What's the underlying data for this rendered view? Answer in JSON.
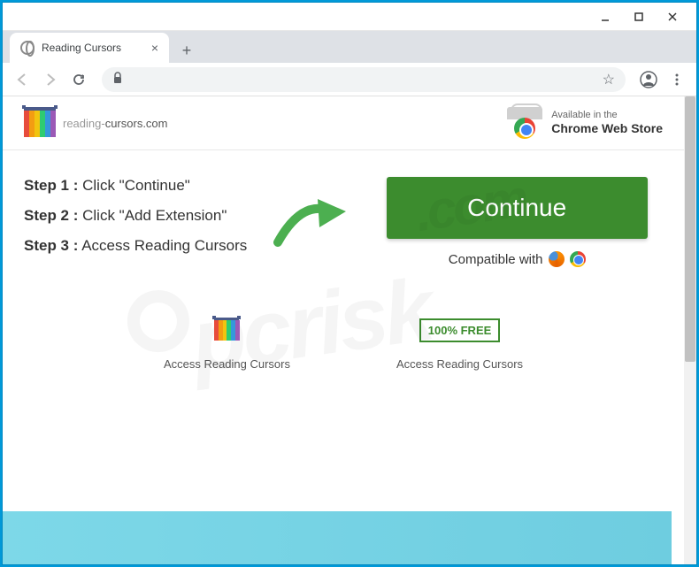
{
  "window": {
    "tab_title": "Reading Cursors"
  },
  "header": {
    "logo_text_prefix": "reading-",
    "logo_text_suffix": "cursors.com",
    "cws_line1": "Available in the",
    "cws_line2": "Chrome Web Store"
  },
  "steps": [
    {
      "label": "Step 1 :",
      "text": " Click \"Continue\""
    },
    {
      "label": "Step 2 :",
      "text": " Click \"Add Extension\""
    },
    {
      "label": "Step 3 :",
      "text": " Access Reading Cursors"
    }
  ],
  "cta": {
    "continue_label": "Continue",
    "compatible_label": "Compatible with"
  },
  "features": [
    {
      "icon": "logo",
      "label": "Access Reading Cursors"
    },
    {
      "icon": "free",
      "badge": "100% FREE",
      "label": "Access Reading Cursors"
    }
  ],
  "watermark": "pcrisk.com"
}
